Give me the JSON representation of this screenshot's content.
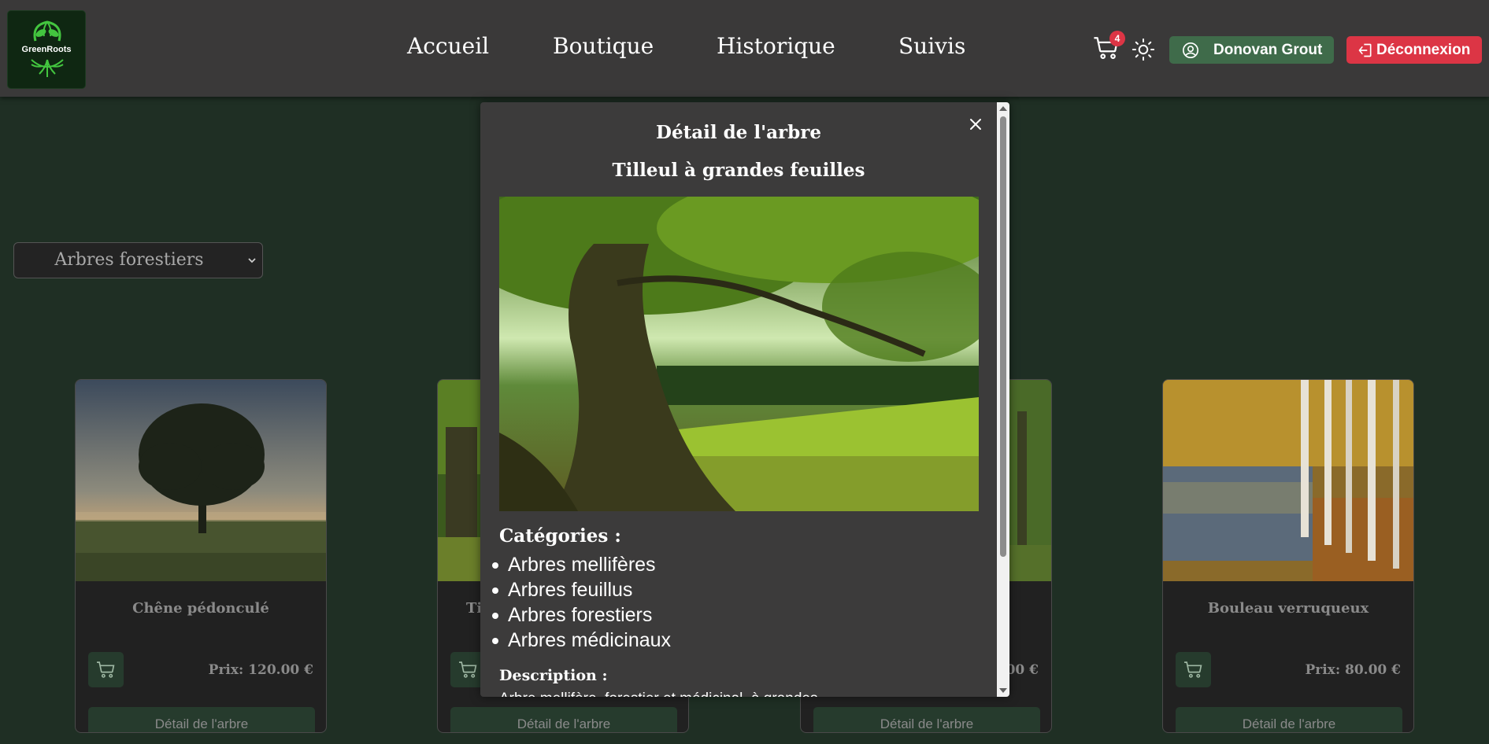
{
  "header": {
    "logo_text": "GreenRoots",
    "nav": [
      "Accueil",
      "Boutique",
      "Historique",
      "Suivis"
    ],
    "cart_count": "4",
    "user_name": "Donovan Grout",
    "logout_label": "Déconnexion"
  },
  "filter": {
    "selected": "Arbres forestiers"
  },
  "cards": [
    {
      "name": "Chêne pédonculé",
      "price": "Prix: 120.00 €",
      "detail_label": "Détail de l'arbre"
    },
    {
      "name": "Ti",
      "price": "",
      "detail_label": "Détail de l'arbre"
    },
    {
      "name": "",
      "price": "00 €",
      "detail_label": "Détail de l'arbre"
    },
    {
      "name": "Bouleau verruqueux",
      "price": "Prix: 80.00 €",
      "detail_label": "Détail de l'arbre"
    }
  ],
  "modal": {
    "title": "Détail de l'arbre",
    "subtitle": "Tilleul à grandes feuilles",
    "categories_heading": "Catégories :",
    "categories": [
      "Arbres mellifères",
      "Arbres feuillus",
      "Arbres forestiers",
      "Arbres médicinaux"
    ],
    "description_heading": "Description :",
    "description_text": "Arbre mellifère, forestier et médicinal, à grandes"
  },
  "colors": {
    "background": "#1f2f24",
    "header": "#3a3939",
    "user_button": "#3f6b4a",
    "logout_button": "#dc3545",
    "card": "#212121",
    "card_button": "#263b2d",
    "modal": "#3c3b3b"
  },
  "icons": {
    "cart": "cart-icon",
    "theme": "sun-icon",
    "user": "user-circle-icon",
    "logout": "logout-icon",
    "close": "close-icon",
    "select_arrow": "chevron-down-icon"
  }
}
